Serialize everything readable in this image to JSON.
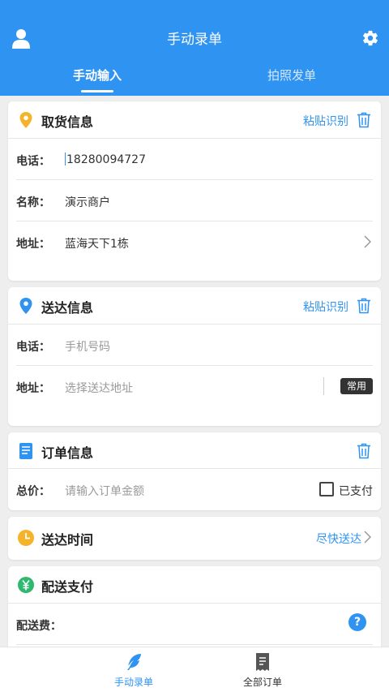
{
  "header": {
    "title": "手动录单"
  },
  "tabs": [
    {
      "label": "手动输入"
    },
    {
      "label": "拍照发单"
    }
  ],
  "pickup": {
    "title": "取货信息",
    "paste_label": "粘贴识别",
    "phone_label": "电话：",
    "phone_value": "18280094727",
    "name_label": "名称：",
    "name_value": "演示商户",
    "address_label": "地址：",
    "address_value": "蓝海天下1栋"
  },
  "delivery": {
    "title": "送达信息",
    "paste_label": "粘贴识别",
    "phone_label": "电话：",
    "phone_placeholder": "手机号码",
    "address_label": "地址：",
    "address_placeholder": "选择送达地址",
    "common_label": "常用"
  },
  "order": {
    "title": "订单信息",
    "total_label": "总价：",
    "total_placeholder": "请输入订单金额",
    "paid_label": "已支付"
  },
  "time": {
    "title": "送达时间",
    "value": "尽快送达"
  },
  "payment": {
    "title": "配送支付",
    "fee_label": "配送费：",
    "help_icon": "?"
  },
  "bottom_nav": [
    {
      "label": "手动录单"
    },
    {
      "label": "全部订单"
    }
  ],
  "colors": {
    "primary": "#2f93f2",
    "pickup_pin": "#f5b32b",
    "clock": "#f5b32b",
    "pay_green": "#2fb86e"
  }
}
